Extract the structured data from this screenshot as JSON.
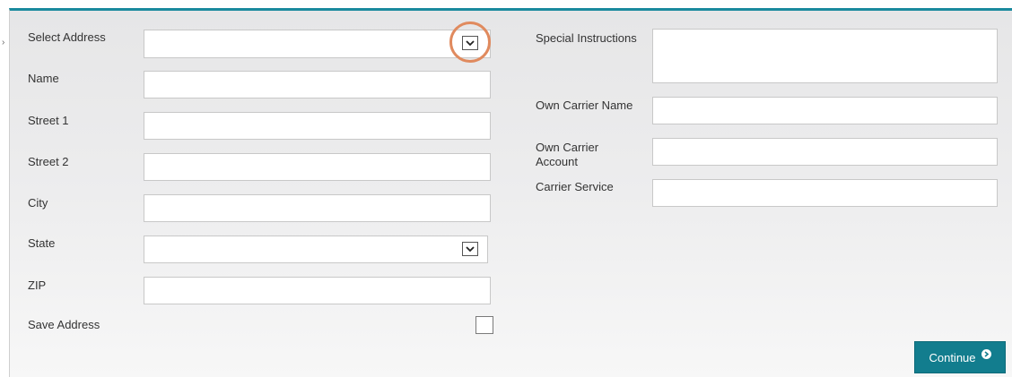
{
  "left": {
    "select_address": "Select Address",
    "name": "Name",
    "street1": "Street 1",
    "street2": "Street 2",
    "city": "City",
    "state": "State",
    "zip": "ZIP",
    "save_address": "Save Address"
  },
  "right": {
    "special_instructions": "Special Instructions",
    "own_carrier_name": "Own Carrier Name",
    "own_carrier_account_line1": "Own Carrier",
    "own_carrier_account_line2": "Account",
    "carrier_service": "Carrier Service"
  },
  "buttons": {
    "continue_label": "Continue"
  },
  "icons": {
    "dropdown": "chevron-down-icon",
    "continue": "arrow-right-circle-icon"
  },
  "colors": {
    "accent": "#1a8a9e",
    "button": "#127d8e",
    "highlight_ring": "#e08a5e"
  }
}
